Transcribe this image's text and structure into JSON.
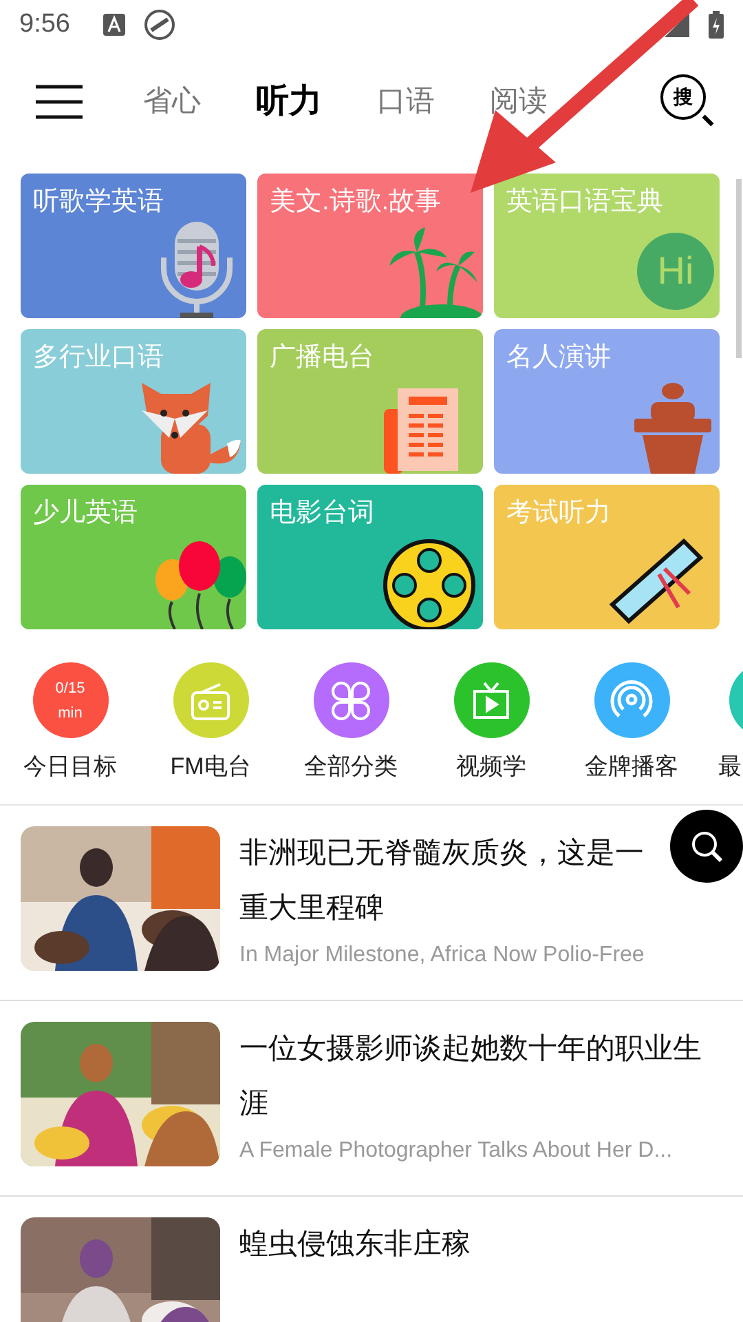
{
  "status_bar": {
    "time": "9:56"
  },
  "header": {
    "tabs": [
      {
        "label": "省心",
        "selected": false
      },
      {
        "label": "听力",
        "selected": true
      },
      {
        "label": "口语",
        "selected": false
      },
      {
        "label": "阅读",
        "selected": false
      }
    ],
    "search_label": "搜"
  },
  "tiles": [
    {
      "label": "听歌学英语",
      "color": "#5d85d5",
      "kind": "mic"
    },
    {
      "label": "美文.诗歌.故事",
      "color": "#f87279",
      "kind": "palm"
    },
    {
      "label": "英语口语宝典",
      "color": "#b0d96a",
      "kind": "hi",
      "badge": "Hi"
    },
    {
      "label": "多行业口语",
      "color": "#89cdd8",
      "kind": "fox"
    },
    {
      "label": "广播电台",
      "color": "#a5cd5c",
      "kind": "newspaper"
    },
    {
      "label": "名人演讲",
      "color": "#8ea8f0",
      "kind": "podium"
    },
    {
      "label": "少儿英语",
      "color": "#70c84a",
      "kind": "balloons"
    },
    {
      "label": "电影台词",
      "color": "#22b89a",
      "kind": "film"
    },
    {
      "label": "考试听力",
      "color": "#f3c650",
      "kind": "diploma"
    }
  ],
  "shortcuts": [
    {
      "label": "今日目标",
      "color": "#fb5143",
      "kind": "goal",
      "progress": "0/15",
      "unit": "min"
    },
    {
      "label": "FM电台",
      "color": "#cdd936",
      "kind": "radio"
    },
    {
      "label": "全部分类",
      "color": "#b56bfb",
      "kind": "grid"
    },
    {
      "label": "视频学",
      "color": "#2cc22c",
      "kind": "tv"
    },
    {
      "label": "金牌播客",
      "color": "#3cb2fb",
      "kind": "podcast"
    },
    {
      "label": "最",
      "color": "#27c7b0",
      "kind": "blank"
    }
  ],
  "articles": [
    {
      "title": "非洲现已无脊髓灰质炎，这是一重大里程碑",
      "subtitle": "In Major Milestone, Africa Now Polio-Free"
    },
    {
      "title": "一位女摄影师谈起她数十年的职业生涯",
      "subtitle": "A Female Photographer Talks About Her D..."
    },
    {
      "title": "蝗虫侵蚀东非庄稼"
    }
  ]
}
